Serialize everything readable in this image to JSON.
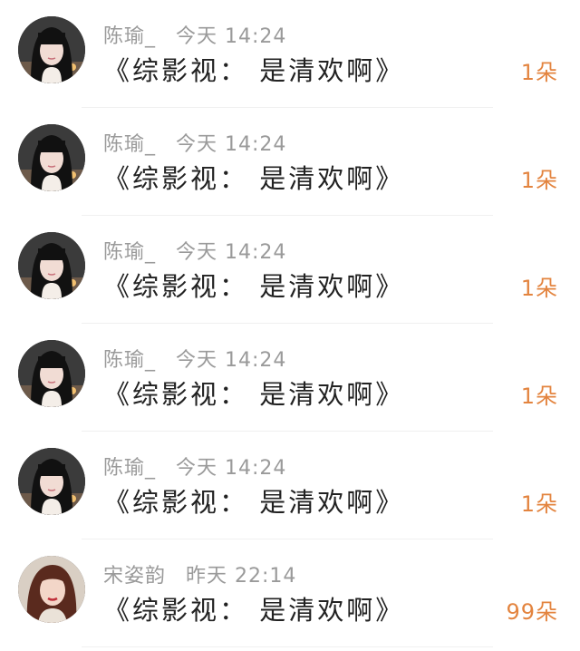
{
  "accent_color": "#e3843f",
  "items": [
    {
      "name": "陈瑜_",
      "time": "今天 14:24",
      "message": "《综影视： 是清欢啊》",
      "count": "1朵",
      "avatar_icon": "avatar-girl-dark-hair"
    },
    {
      "name": "陈瑜_",
      "time": "今天 14:24",
      "message": "《综影视： 是清欢啊》",
      "count": "1朵",
      "avatar_icon": "avatar-girl-dark-hair"
    },
    {
      "name": "陈瑜_",
      "time": "今天 14:24",
      "message": "《综影视： 是清欢啊》",
      "count": "1朵",
      "avatar_icon": "avatar-girl-dark-hair"
    },
    {
      "name": "陈瑜_",
      "time": "今天 14:24",
      "message": "《综影视： 是清欢啊》",
      "count": "1朵",
      "avatar_icon": "avatar-girl-dark-hair"
    },
    {
      "name": "陈瑜_",
      "time": "今天 14:24",
      "message": "《综影视： 是清欢啊》",
      "count": "1朵",
      "avatar_icon": "avatar-girl-dark-hair"
    },
    {
      "name": "宋姿韵",
      "time": "昨天 22:14",
      "message": "《综影视： 是清欢啊》",
      "count": "99朵",
      "avatar_icon": "avatar-woman-auburn-hair"
    }
  ]
}
